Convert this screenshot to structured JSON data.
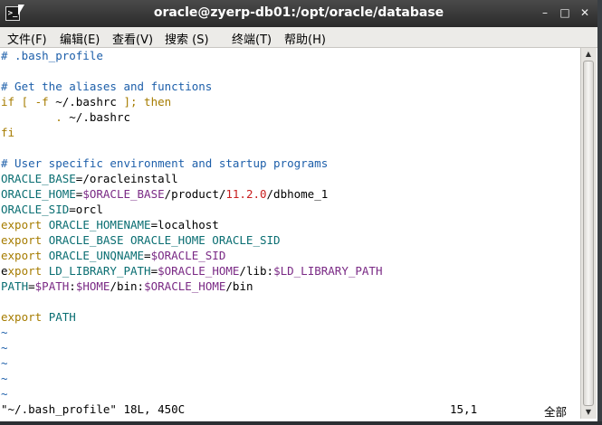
{
  "window": {
    "title": "oracle@zyerp-db01:/opt/oracle/database",
    "app_icon": ">_",
    "minimize_icon": "–",
    "maximize_icon": "□",
    "close_icon": "✕"
  },
  "menu": {
    "items": [
      "文件(F)",
      "编辑(E)",
      "查看(V)",
      "搜索 (S)",
      "终端(T)",
      "帮助(H)"
    ]
  },
  "editor": {
    "lines": [
      [
        {
          "t": "# .bash_profile",
          "c": "comment"
        }
      ],
      [],
      [
        {
          "t": "# Get the aliases and functions",
          "c": "comment"
        }
      ],
      [
        {
          "t": "if [ -f ",
          "c": "keyword"
        },
        {
          "t": "~/.bashrc",
          "c": "plain"
        },
        {
          "t": " ]; then",
          "c": "keyword"
        }
      ],
      [
        {
          "t": "        . ",
          "c": "keyword"
        },
        {
          "t": "~/.bashrc",
          "c": "plain"
        }
      ],
      [
        {
          "t": "fi",
          "c": "keyword"
        }
      ],
      [],
      [
        {
          "t": "# User specific environment and startup programs",
          "c": "comment"
        }
      ],
      [
        {
          "t": "ORACLE_BASE",
          "c": "var"
        },
        {
          "t": "=/oracleinstall",
          "c": "plain"
        }
      ],
      [
        {
          "t": "ORACLE_HOME",
          "c": "var"
        },
        {
          "t": "=",
          "c": "plain"
        },
        {
          "t": "$ORACLE_BASE",
          "c": "ident"
        },
        {
          "t": "/product/",
          "c": "plain"
        },
        {
          "t": "11.2.0",
          "c": "num"
        },
        {
          "t": "/dbhome_1",
          "c": "plain"
        }
      ],
      [
        {
          "t": "ORACLE_SID",
          "c": "var"
        },
        {
          "t": "=orcl",
          "c": "plain"
        }
      ],
      [
        {
          "t": "export ",
          "c": "keyword"
        },
        {
          "t": "ORACLE_HOMENAME",
          "c": "var"
        },
        {
          "t": "=localhost",
          "c": "plain"
        }
      ],
      [
        {
          "t": "export ",
          "c": "keyword"
        },
        {
          "t": "ORACLE_BASE ORACLE_HOME ORACLE_SID",
          "c": "var"
        }
      ],
      [
        {
          "t": "export ",
          "c": "keyword"
        },
        {
          "t": "ORACLE_UNQNAME",
          "c": "var"
        },
        {
          "t": "=",
          "c": "plain"
        },
        {
          "t": "$ORACLE_SID",
          "c": "ident"
        }
      ],
      [
        {
          "t": "e",
          "c": "cursor"
        },
        {
          "t": "xport ",
          "c": "keyword"
        },
        {
          "t": "LD_LIBRARY_PATH",
          "c": "var"
        },
        {
          "t": "=",
          "c": "plain"
        },
        {
          "t": "$ORACLE_HOME",
          "c": "ident"
        },
        {
          "t": "/lib:",
          "c": "plain"
        },
        {
          "t": "$LD_LIBRARY_PATH",
          "c": "ident"
        }
      ],
      [
        {
          "t": "PATH",
          "c": "var"
        },
        {
          "t": "=",
          "c": "plain"
        },
        {
          "t": "$PATH",
          "c": "ident"
        },
        {
          "t": ":",
          "c": "plain"
        },
        {
          "t": "$HOME",
          "c": "ident"
        },
        {
          "t": "/bin:",
          "c": "plain"
        },
        {
          "t": "$ORACLE_HOME",
          "c": "ident"
        },
        {
          "t": "/bin",
          "c": "plain"
        }
      ],
      [],
      [
        {
          "t": "export ",
          "c": "keyword"
        },
        {
          "t": "PATH",
          "c": "var"
        }
      ],
      [
        {
          "t": "~",
          "c": "tilde"
        }
      ],
      [
        {
          "t": "~",
          "c": "tilde"
        }
      ],
      [
        {
          "t": "~",
          "c": "tilde"
        }
      ],
      [
        {
          "t": "~",
          "c": "tilde"
        }
      ],
      [
        {
          "t": "~",
          "c": "tilde"
        }
      ]
    ]
  },
  "status": {
    "file_info": "\"~/.bash_profile\" 18L, 450C",
    "cursor_pos": "15,1",
    "scroll_pos": "全部"
  },
  "colors": {
    "comment": "#1d5faa",
    "keyword": "#a67c00",
    "var": "#0a6e72",
    "ident": "#7a2a85",
    "num": "#c81e1e",
    "cursor": "#a68400"
  },
  "icons": {
    "scroll_up": "chevron-up-icon",
    "scroll_down": "chevron-down-icon",
    "app": "terminal-icon"
  }
}
